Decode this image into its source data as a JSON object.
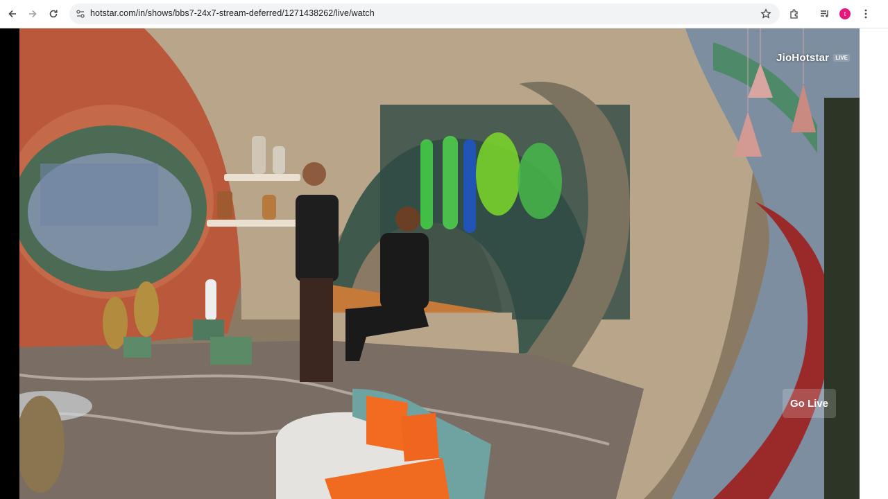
{
  "browser": {
    "url": "hotstar.com/in/shows/bbs7-24x7-stream-deferred/1271438262/live/watch",
    "avatar_letter": "t",
    "icons": [
      "back-icon",
      "forward-icon",
      "reload-icon",
      "site-info-icon",
      "bookmark-star-icon",
      "extensions-icon",
      "media-controls-icon",
      "profile-avatar",
      "kebab-menu-icon"
    ]
  },
  "player": {
    "brand": "JioHotstar",
    "live_badge": "LIVE",
    "go_live_label": "Go Live"
  }
}
